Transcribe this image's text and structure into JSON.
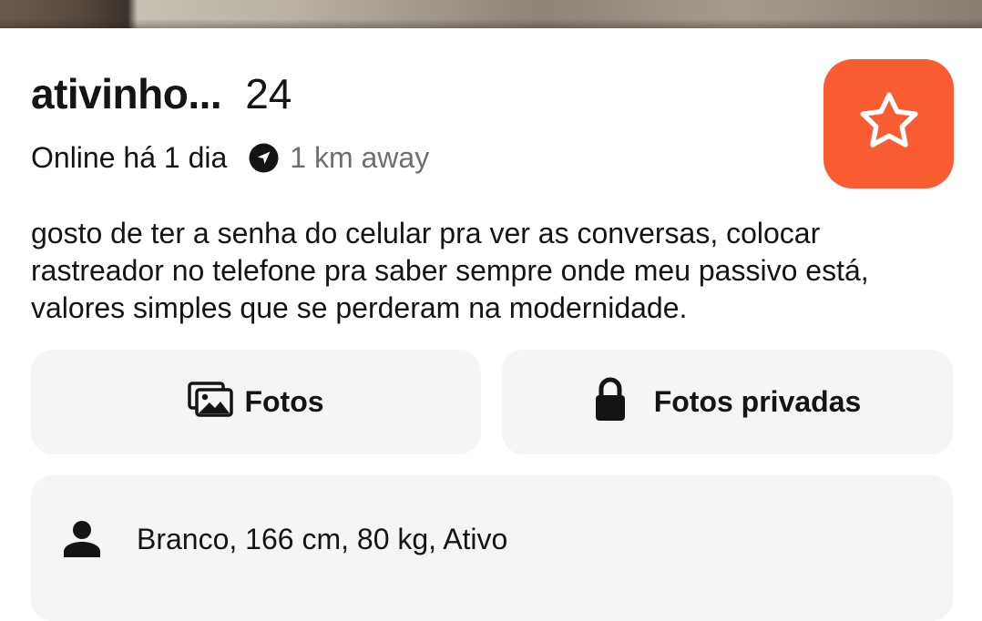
{
  "profile": {
    "display_name": "ativinho...",
    "age": "24",
    "online_status": "Online há 1 dia",
    "distance": "1 km away",
    "bio": "gosto de ter a senha do celular pra ver as conversas, colocar rastreador no telefone pra saber sempre onde meu passivo está, valores simples que se perderam na modernidade.",
    "details": "Branco, 166 cm, 80 kg, Ativo"
  },
  "actions": {
    "photos_label": "Fotos",
    "private_photos_label": "Fotos privadas"
  },
  "icons": {
    "favorite": "star-outline-icon",
    "location": "navigation-arrow-icon",
    "photos": "photo-gallery-icon",
    "private": "lock-icon",
    "details": "person-icon"
  },
  "colors": {
    "accent": "#fa5c32",
    "card_background": "#f5f5f5",
    "secondary_text": "#6f6f6f"
  }
}
